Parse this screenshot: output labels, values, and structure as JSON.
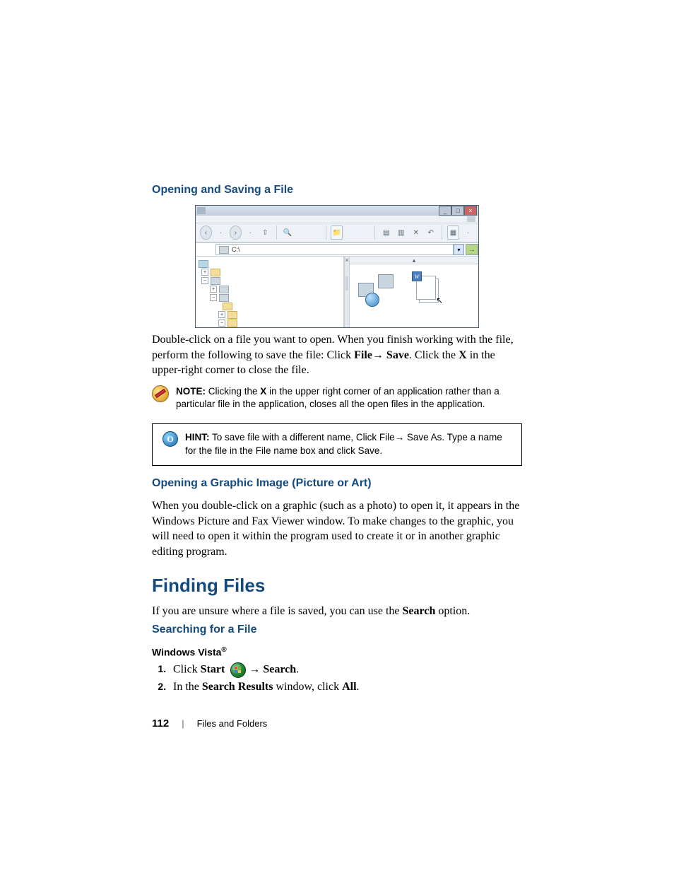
{
  "headings": {
    "open_save": "Opening and Saving a File",
    "open_graphic": "Opening a Graphic Image (Picture or Art)",
    "finding_files": "Finding Files",
    "searching": "Searching for a File",
    "vista": "Windows Vista"
  },
  "window": {
    "address_path": "C:\\",
    "pane_close": "×",
    "header_glyph": "▲",
    "win_min": "_",
    "win_max": "□",
    "win_close": "×",
    "doc_badge": "W",
    "back": "‹",
    "dot1": "·",
    "fwd": "›",
    "dot2": "·",
    "up": "⇧",
    "search": "🔍",
    "folders": "📁",
    "move": "▤",
    "copy": "▥",
    "delete": "✕",
    "undo": "↶",
    "views": "▦",
    "views_caret": "·",
    "addr_caret": "▾",
    "go": "→"
  },
  "body": {
    "after_window_1": "Double-click on a file you want to open. When you finish working with the file, perform the following to save the file: Click ",
    "file_arrow_save": "File→ Save",
    "after_window_2": ". Click the ",
    "x_bold": "X",
    "after_window_3": " in the upper-right corner to close the file.",
    "graphic_para": "When you double-click on a graphic (such as a photo) to open it, it appears in the Windows Picture and Fax Viewer window. To make changes to the graphic, you will need to open it within the program used to create it or in another graphic editing program.",
    "finding_intro_1": "If you are unsure where a file is saved, you can use the ",
    "finding_search": "Search",
    "finding_intro_2": " option."
  },
  "note": {
    "label": "NOTE:",
    "text_1": " Clicking the ",
    "x": "X",
    "text_2": " in the upper right corner of an application rather than a particular file in the application, closes all the open files in the application."
  },
  "hint": {
    "label": "HINT:",
    "text": " To save file with a different name, Click File→ Save As. Type a name for the file in the File name box and click Save.",
    "icon_glyph": "O"
  },
  "steps": {
    "s1_a": "Click ",
    "s1_start": "Start",
    "s1_b": " → ",
    "s1_search": "Search",
    "s1_c": ".",
    "s2_a": "In the ",
    "s2_win": "Search Results",
    "s2_b": " window, click ",
    "s2_all": "All",
    "s2_c": "."
  },
  "footer": {
    "page": "112",
    "divider": "|",
    "section": "Files and Folders"
  }
}
